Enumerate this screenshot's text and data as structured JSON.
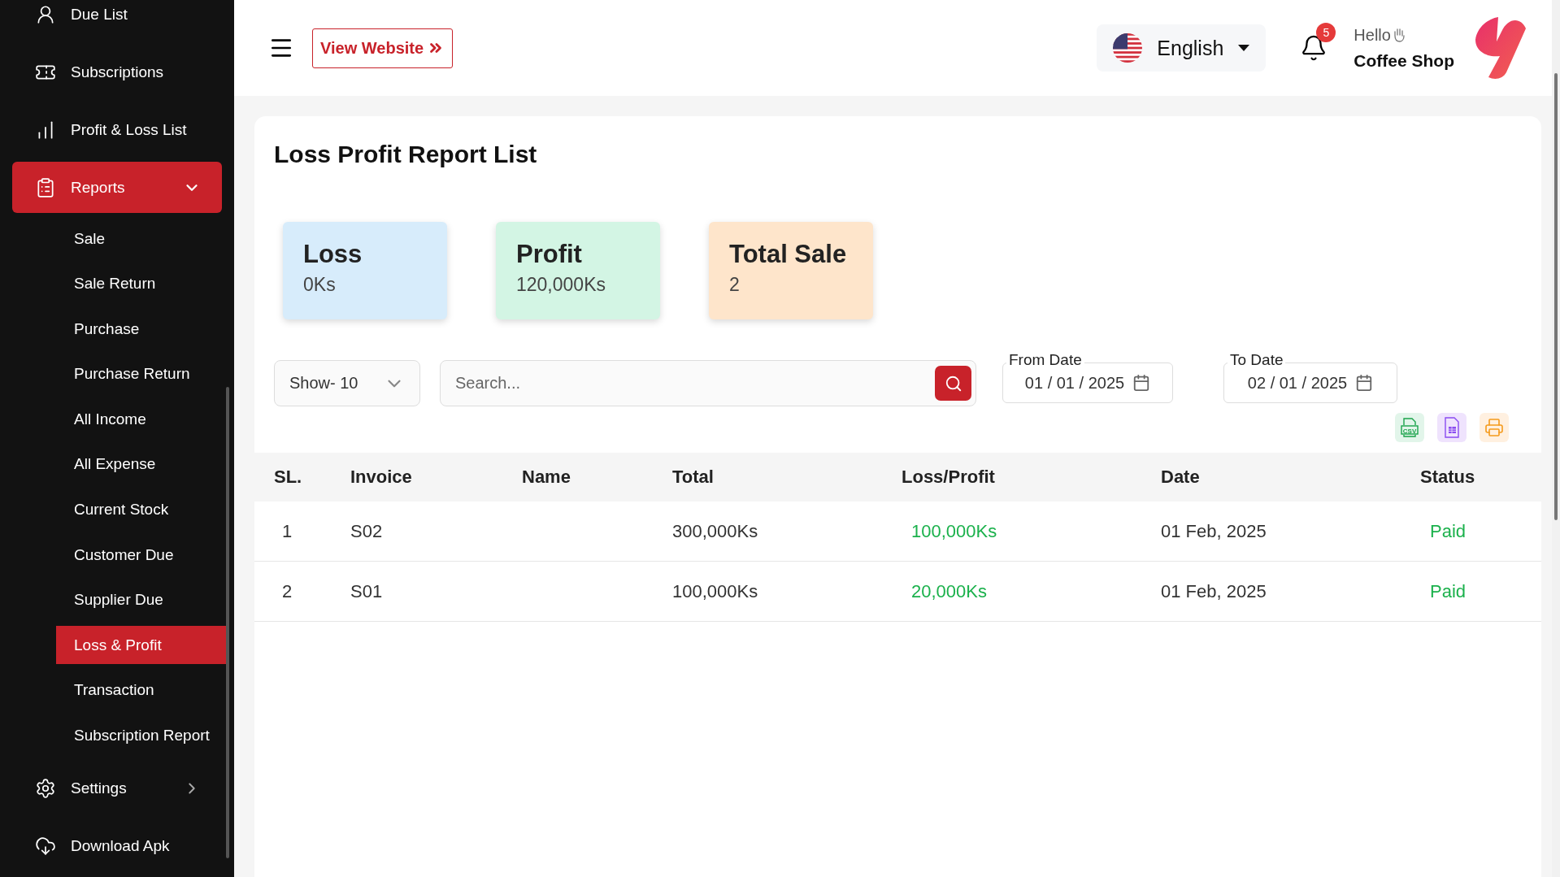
{
  "sidebar": {
    "items": [
      {
        "kind": "link",
        "label": "Due List"
      },
      {
        "kind": "link",
        "label": "Subscriptions"
      },
      {
        "kind": "link",
        "label": "Profit & Loss List"
      },
      {
        "kind": "group",
        "label": "Reports",
        "expanded": true,
        "selected": true,
        "children": [
          {
            "label": "Sale",
            "selected": false
          },
          {
            "label": "Sale Return",
            "selected": false
          },
          {
            "label": "Purchase",
            "selected": false
          },
          {
            "label": "Purchase Return",
            "selected": false
          },
          {
            "label": "All Income",
            "selected": false
          },
          {
            "label": "All Expense",
            "selected": false
          },
          {
            "label": "Current Stock",
            "selected": false
          },
          {
            "label": "Customer Due",
            "selected": false
          },
          {
            "label": "Supplier Due",
            "selected": false
          },
          {
            "label": "Loss & Profit",
            "selected": true
          },
          {
            "label": "Transaction",
            "selected": false
          },
          {
            "label": "Subscription Report",
            "selected": false
          }
        ]
      },
      {
        "kind": "group",
        "label": "Settings",
        "expanded": false,
        "selected": false
      },
      {
        "kind": "link",
        "label": "Download Apk"
      }
    ]
  },
  "header": {
    "view_website": "View Website",
    "language": "English",
    "notification_count": "5",
    "greeting": "Hello",
    "user": "Coffee Shop"
  },
  "page": {
    "title": "Loss Profit Report List",
    "stats": [
      {
        "label": "Loss",
        "value": "0Ks",
        "color": "#d7ecfb"
      },
      {
        "label": "Profit",
        "value": "120,000Ks",
        "color": "#d3f5e4"
      },
      {
        "label": "Total Sale",
        "value": "2",
        "color": "#fee5cb"
      }
    ],
    "filters": {
      "show": "Show- 10",
      "search": {
        "placeholder": "Search..."
      },
      "from_date": {
        "label": "From Date",
        "value": "01 / 01 / 2025"
      },
      "to_date": {
        "label": "To Date",
        "value": "02 / 01 / 2025"
      }
    },
    "exports": [
      {
        "kind": "csv",
        "label": "CSV"
      },
      {
        "kind": "sheet"
      },
      {
        "kind": "print"
      }
    ],
    "table": {
      "columns": [
        "SL.",
        "Invoice",
        "Name",
        "Total",
        "Loss/Profit",
        "Date",
        "Status"
      ],
      "rows": [
        {
          "sl": "1",
          "invoice": "S02",
          "total": "300,000Ks",
          "loss_profit": "100,000Ks",
          "date": "01 Feb, 2025",
          "status": "Paid"
        },
        {
          "sl": "2",
          "invoice": "S01",
          "total": "100,000Ks",
          "loss_profit": "20,000Ks",
          "date": "01 Feb, 2025",
          "status": "Paid"
        }
      ]
    }
  }
}
